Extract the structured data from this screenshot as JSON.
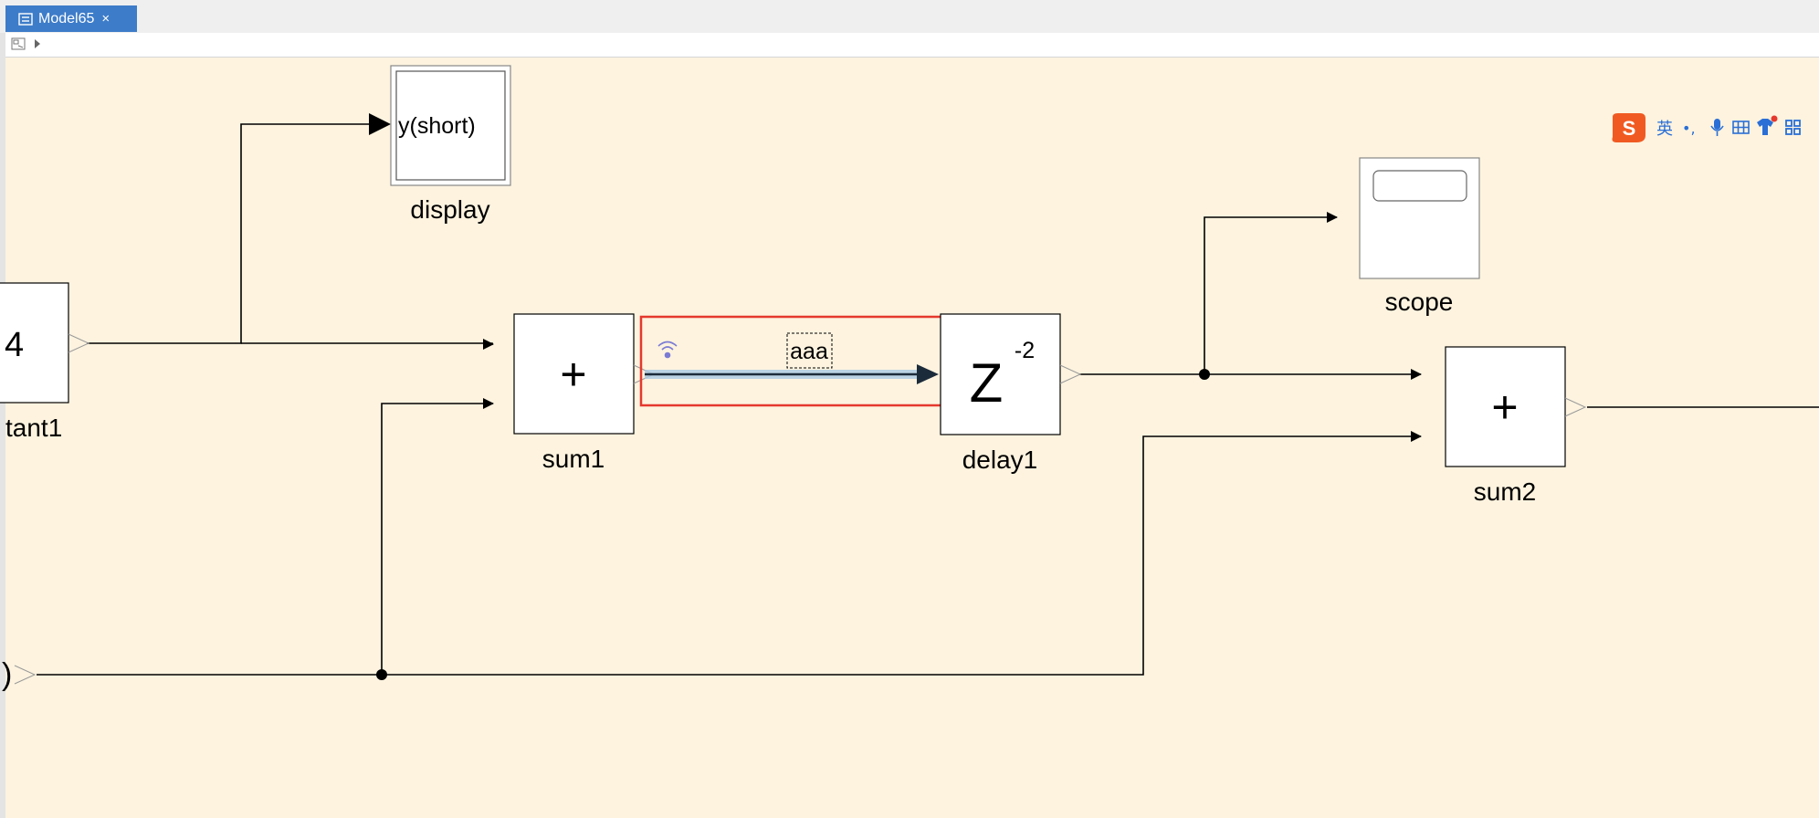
{
  "tab": {
    "title": "Model65",
    "close": "×"
  },
  "blocks": {
    "constant_value": "4",
    "constant_name": "tant1",
    "display_text": "y(short)",
    "display_name": "display",
    "sum1_symbol": "+",
    "sum1_name": "sum1",
    "delay_symbol": "Z",
    "delay_exponent": "-2",
    "delay_name": "delay1",
    "scope_name": "scope",
    "sum2_symbol": "+",
    "sum2_name": "sum2",
    "source_glyph": ")"
  },
  "signal_label": "aaa",
  "ime": {
    "lang": "英",
    "punct": "•,"
  },
  "colors": {
    "canvas": "#fdf3df",
    "selection": "#e5382e",
    "tab": "#3d7cc9",
    "ime_logo": "#f05a22",
    "ime_icons": "#2a6fd6"
  }
}
